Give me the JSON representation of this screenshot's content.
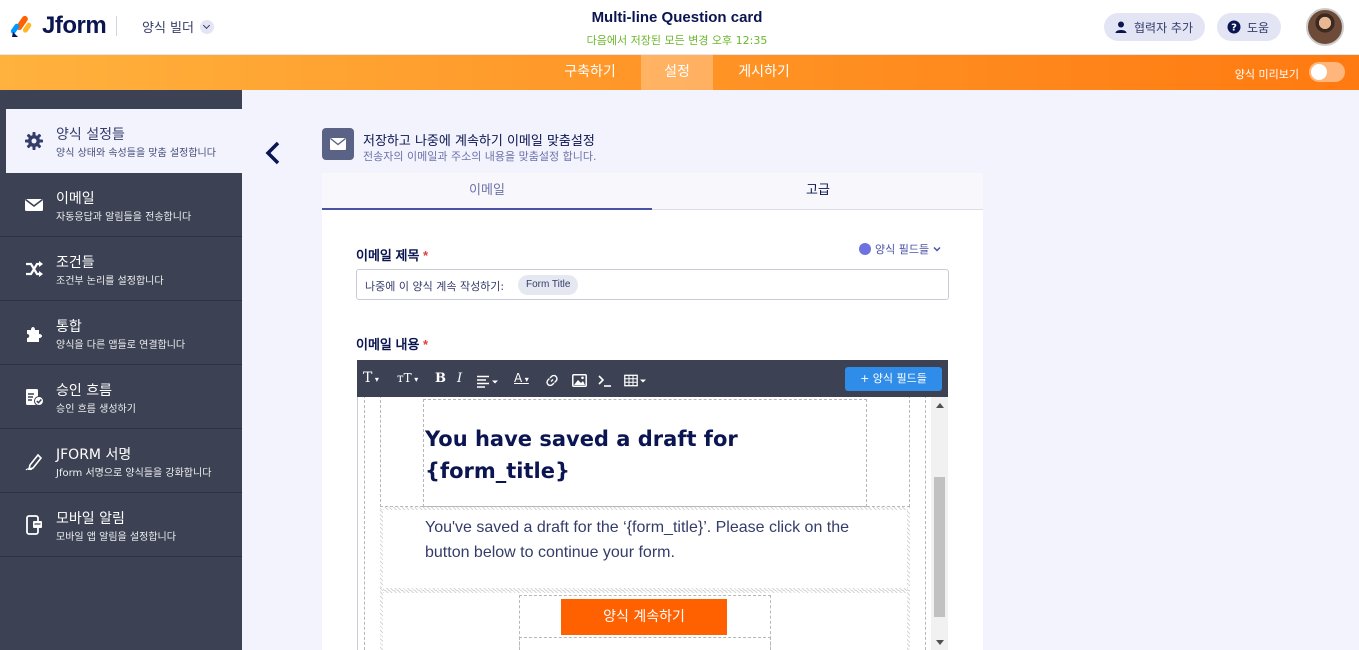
{
  "header": {
    "logo_text": "Jform",
    "builder_label": "양식 빌더",
    "form_title": "Multi-line Question card",
    "save_status": "다음에서 저장된 모든 변경 오후 12:35",
    "add_collaborator": "협력자 추가",
    "help": "도움"
  },
  "nav": {
    "tabs": [
      "구축하기",
      "설정",
      "게시하기"
    ],
    "active_tab": "설정",
    "preview_label": "양식 미리보기",
    "preview_on": false
  },
  "sidebar": {
    "items": [
      {
        "title": "양식 설정들",
        "desc": "양식 상태와 속성들을 맞춤 설정합니다",
        "icon": "gear-icon",
        "active": true
      },
      {
        "title": "이메일",
        "desc": "자동응답과 알림들을 전송합니다",
        "icon": "envelope-icon",
        "active": false
      },
      {
        "title": "조건들",
        "desc": "조건부 논리를 설정합니다",
        "icon": "shuffle-icon",
        "active": false
      },
      {
        "title": "통합",
        "desc": "양식을 다른 앱들로 연결합니다",
        "icon": "puzzle-icon",
        "active": false
      },
      {
        "title": "승인 흐름",
        "desc": "승인 흐름 생성하기",
        "icon": "approval-icon",
        "active": false
      },
      {
        "title": "JFORM 서명",
        "desc": "Jform 서명으로 양식들을 강화합니다",
        "icon": "pen-icon",
        "active": false
      },
      {
        "title": "모바일 알림",
        "desc": "모바일 앱 알림을 설정합니다",
        "icon": "mobile-icon",
        "active": false
      }
    ]
  },
  "panel": {
    "title": "저장하고 나중에 계속하기 이메일 맞춤설정",
    "subtitle": "전송자의 이메일과 주소의 내용을 맞춤설정 합니다.",
    "tabs": [
      "이메일",
      "고급"
    ],
    "active_tab": "이메일"
  },
  "email": {
    "subject_label": "이메일 제목",
    "required_mark": "*",
    "form_fields_link": "양식 필드들",
    "subject_text": "나중에 이 양식 계속 작성하기:",
    "subject_chip": "Form Title",
    "body_label": "이메일 내용",
    "add_field_button": "+ 양식 필드들",
    "toolbar": {
      "font": "T",
      "size": "тT",
      "bold": "B",
      "italic": "I",
      "color": "A"
    },
    "draft_heading": "You have saved a draft for {form_title}",
    "draft_body": "You've saved a draft for the ‘{form_title}’. Please click on the button below to continue your form.",
    "continue_button": "양식 계속하기"
  },
  "colors": {
    "brand_navy": "#0a1551",
    "orange": "#ff6100",
    "sidebar_bg": "#3c4253",
    "accent_blue": "#2f8ce8",
    "save_green": "#6bb72b"
  }
}
